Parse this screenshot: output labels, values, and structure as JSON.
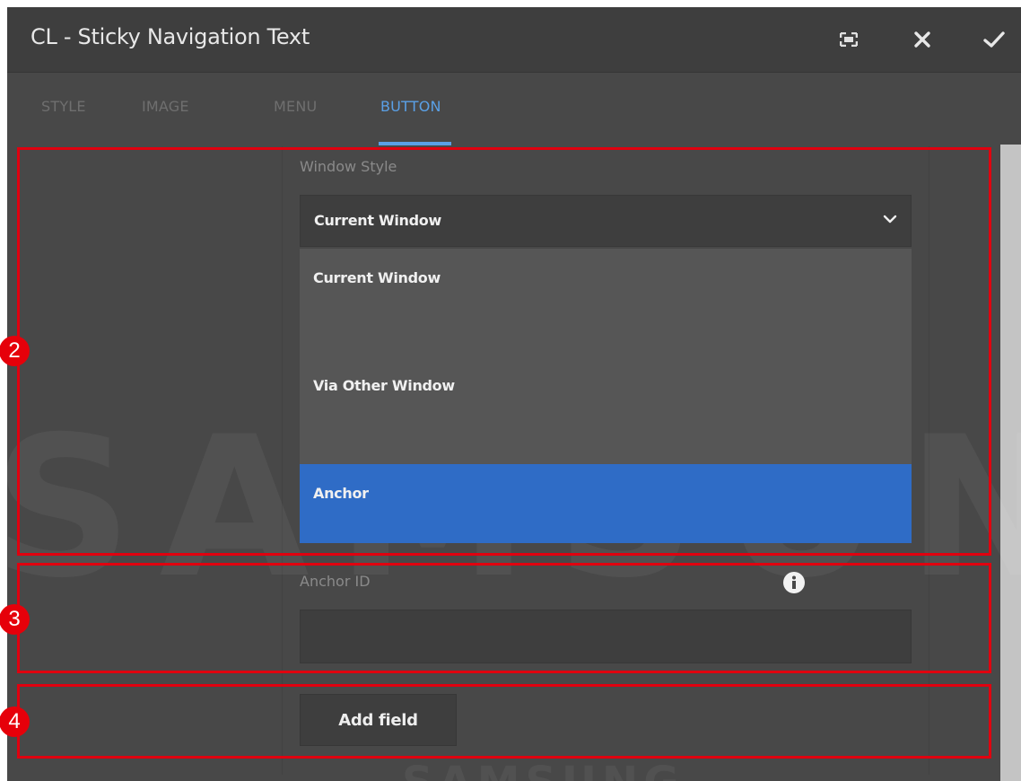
{
  "dialog": {
    "title": "CL - Sticky Navigation Text",
    "fullscreen_icon": "fullscreen-icon",
    "close_icon": "close-icon",
    "confirm_icon": "check-icon"
  },
  "tabs": [
    {
      "label": "STYLE",
      "active": false
    },
    {
      "label": "IMAGE",
      "active": false
    },
    {
      "label": "MENU",
      "active": false
    },
    {
      "label": "BUTTON",
      "active": true
    }
  ],
  "window_style": {
    "label": "Window Style",
    "selected": "Current Window",
    "options": [
      {
        "label": "Current Window",
        "highlighted": false
      },
      {
        "label": "Via Other Window",
        "highlighted": false
      },
      {
        "label": "Anchor",
        "highlighted": true
      }
    ]
  },
  "anchor_id": {
    "label": "Anchor ID",
    "value": "",
    "info_icon": "info-icon"
  },
  "add_field": {
    "label": "Add field"
  },
  "annotations": [
    {
      "number": "2"
    },
    {
      "number": "3"
    },
    {
      "number": "4"
    }
  ],
  "watermark": {
    "text": "SAMSUNG"
  },
  "colors": {
    "accent": "#5aa0e6",
    "highlight_option": "#2f6cc6",
    "annotation_red": "#e6000a",
    "panel_bg": "#484848"
  }
}
